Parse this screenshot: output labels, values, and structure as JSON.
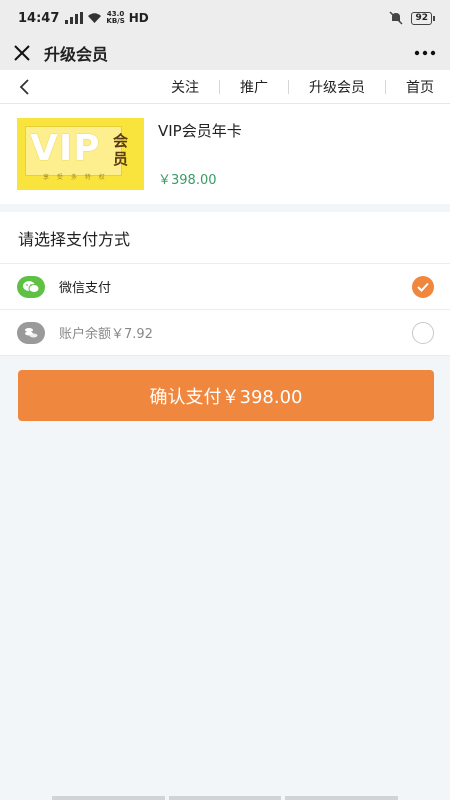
{
  "status": {
    "time": "14:47",
    "speed_top": "43.0",
    "speed_bottom": "KB/S",
    "hd": "HD",
    "battery": "92"
  },
  "titlebar": {
    "title": "升级会员",
    "close_icon": "close-icon",
    "more_icon": "more-icon"
  },
  "navbar": {
    "links": [
      "关注",
      "推广",
      "升级会员",
      "首页"
    ]
  },
  "product": {
    "image": {
      "vip_text": "VIP",
      "vertical_text": "会员",
      "tiny_text": "享 受 多 特 权"
    },
    "name": "VIP会员年卡",
    "price": "￥398.00"
  },
  "payment": {
    "heading": "请选择支付方式",
    "methods": [
      {
        "label": "微信支付",
        "icon": "wechat-icon",
        "checked": true,
        "icon_color": "#5fc143"
      },
      {
        "label": "账户余额￥7.92",
        "icon": "coins-icon",
        "checked": false,
        "icon_color": "#9a9a9a"
      }
    ]
  },
  "confirm_button": {
    "label": "确认支付￥398.00",
    "color": "#f0873f"
  }
}
